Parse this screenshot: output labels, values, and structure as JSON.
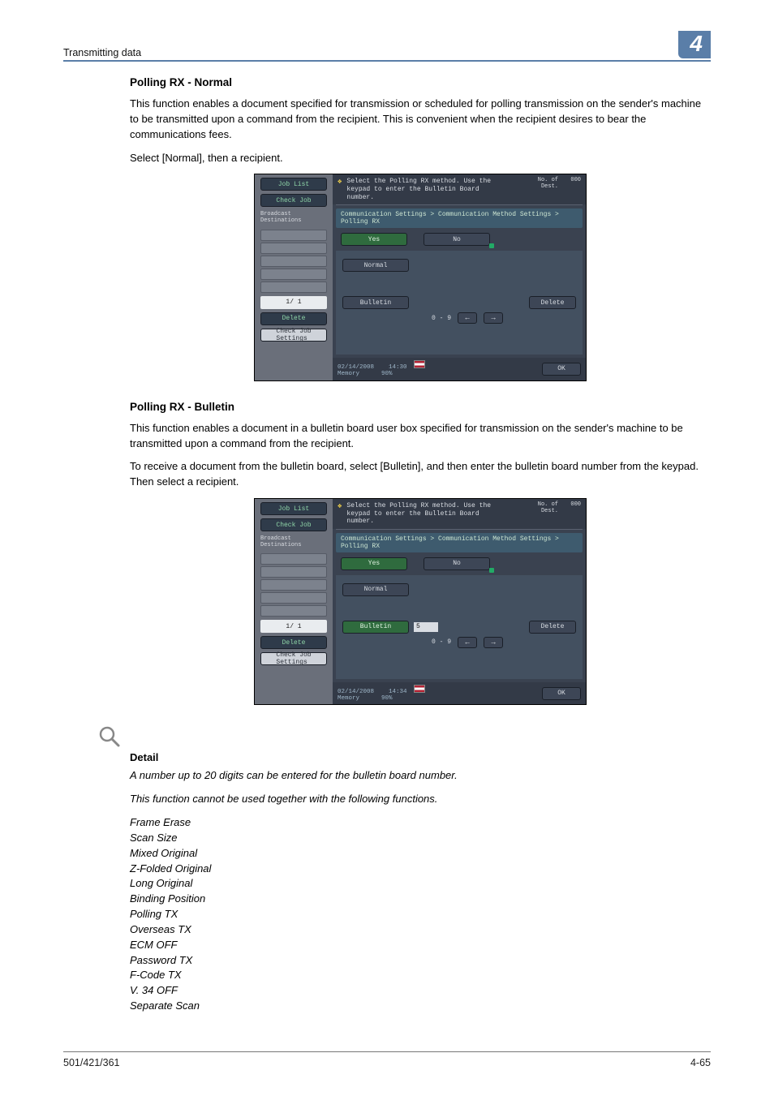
{
  "header": {
    "section_title": "Transmitting data",
    "chapter_number": "4"
  },
  "section1": {
    "heading": "Polling RX - Normal",
    "para1": "This function enables a document specified for transmission or scheduled for polling transmission on the sender's machine to be transmitted upon a command from the recipient. This is convenient when the recipient desires to bear the communications fees.",
    "para2": "Select [Normal], then a recipient."
  },
  "screen1": {
    "job_list": "Job List",
    "check_job": "Check Job",
    "broadcast_label": "Broadcast\nDestinations",
    "pager": "1/  1",
    "side_delete": "Delete",
    "check_job_settings": "Check Job\nSettings",
    "instr": "Select the Polling RX method. Use the\nkeypad to enter the Bulletin Board number.",
    "dest_label": "No. of\nDest.",
    "dest_value": "000",
    "breadcrumb": "Communication Settings > Communication Method Settings > Polling RX",
    "yes": "Yes",
    "no": "No",
    "normal": "Normal",
    "bulletin": "Bulletin",
    "bulletin_input": "",
    "delete": "Delete",
    "range": "0 - 9",
    "arrow_left": "←",
    "arrow_right": "→",
    "date": "02/14/2008",
    "time": "14:30",
    "memory_label": "Memory",
    "memory_value": "90%",
    "ok": "OK"
  },
  "section2": {
    "heading": "Polling RX - Bulletin",
    "para1": "This function enables a document in a bulletin board user box specified for transmission on the sender's machine to be transmitted upon a command from the recipient.",
    "para2": "To receive a document from the bulletin board, select [Bulletin], and then enter the bulletin board number from the keypad. Then select a recipient."
  },
  "screen2": {
    "job_list": "Job List",
    "check_job": "Check Job",
    "broadcast_label": "Broadcast\nDestinations",
    "pager": "1/  1",
    "side_delete": "Delete",
    "check_job_settings": "Check Job\nSettings",
    "instr": "Select the Polling RX method. Use the\nkeypad to enter the Bulletin Board number.",
    "dest_label": "No. of\nDest.",
    "dest_value": "000",
    "breadcrumb": "Communication Settings > Communication Method Settings > Polling RX",
    "yes": "Yes",
    "no": "No",
    "normal": "Normal",
    "bulletin": "Bulletin",
    "bulletin_input": "5",
    "delete": "Delete",
    "range": "0 - 9",
    "arrow_left": "←",
    "arrow_right": "→",
    "date": "02/14/2008",
    "time": "14:34",
    "memory_label": "Memory",
    "memory_value": "90%",
    "ok": "OK"
  },
  "detail": {
    "heading": "Detail",
    "line1": "A number up to 20 digits can be entered for the bulletin board number.",
    "line2": "This function cannot be used together with the following functions.",
    "items": [
      "Frame Erase",
      "Scan Size",
      "Mixed Original",
      "Z-Folded Original",
      "Long Original",
      "Binding Position",
      "Polling TX",
      "Overseas TX",
      "ECM OFF",
      "Password TX",
      "F-Code TX",
      "V. 34 OFF",
      "Separate Scan"
    ]
  },
  "footer": {
    "left": "501/421/361",
    "right": "4-65"
  }
}
